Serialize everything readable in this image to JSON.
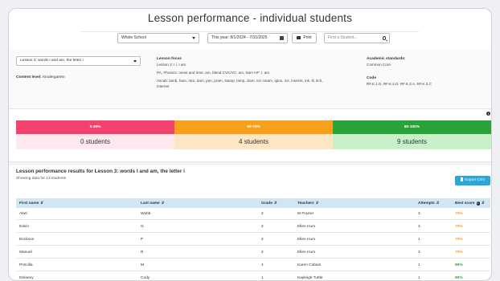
{
  "page": {
    "title": "Lesson performance - individual students"
  },
  "filters": {
    "school": "Whole School",
    "date_range": "This year: 8/1/2024 - 7/31/2025",
    "print_label": "Print",
    "search_placeholder": "Find a Student..."
  },
  "lesson": {
    "selected": "Lesson 3: words I and am, the letter i",
    "content_level_label": "Content level:",
    "content_level_value": "Kindergarten",
    "focus_heading": "Lesson focus",
    "focus_lines": [
      "Lesson 3: I i, I am",
      "PA, Phonics: onset and rime: am, blend CVC/VC: am, Sam HF: I, am",
      "Vocab: lamb, ham, ram, dam, jam, pram, stamp, lamp, clam, ice cream, igloo, ice, insects, ink, ill, itch,",
      "internet"
    ],
    "standards_heading": "Academic standards:",
    "standards_value": "Common Core",
    "code_heading": "Code",
    "code_value": "RF.K.1.D, RF.K.2.D, RF.K.3.A, RF.K.3.C"
  },
  "summary": {
    "bands": [
      {
        "label": "0-49%",
        "count": "0 students",
        "color": "#f2436f",
        "bg": "#fde8ee"
      },
      {
        "label": "50-79%",
        "count": "4 students",
        "color": "#f7a11b",
        "bg": "#fde6c4"
      },
      {
        "label": "80-100%",
        "count": "9 students",
        "color": "#2aa33b",
        "bg": "#c8f1c9"
      }
    ]
  },
  "results": {
    "title": "Lesson performance results for Lesson 3: words I and am, the letter i",
    "subtitle": "Showing data for 13 students",
    "export_label": "Export CSV",
    "columns": [
      "First name",
      "Last name",
      "Grade",
      "Teachers",
      "Attempts",
      "Best score"
    ],
    "rows": [
      {
        "first": "Abel",
        "last": "Webb",
        "grade": "2",
        "teacher": "M Frazier",
        "attempts": "3",
        "score": "70%"
      },
      {
        "first": "Edvin",
        "last": "G",
        "grade": "2",
        "teacher": "Ellen Hum",
        "attempts": "3",
        "score": "70%"
      },
      {
        "first": "Erickson",
        "last": "P",
        "grade": "2",
        "teacher": "Ellen Hum",
        "attempts": "1",
        "score": "70%"
      },
      {
        "first": "Manuel",
        "last": "R",
        "grade": "2",
        "teacher": "Ellen Hum",
        "attempts": "3",
        "score": "70%"
      },
      {
        "first": "Priscilla",
        "last": "M",
        "grade": "4",
        "teacher": "Karen Cobain",
        "attempts": "1",
        "score": "90%"
      },
      {
        "first": "Delaney",
        "last": "Cody",
        "grade": "1",
        "teacher": "Kayleigh Tuttle",
        "attempts": "1",
        "score": "90%"
      }
    ],
    "score_colors": {
      "mid": "#f7a11b",
      "high": "#2aa33b"
    }
  }
}
